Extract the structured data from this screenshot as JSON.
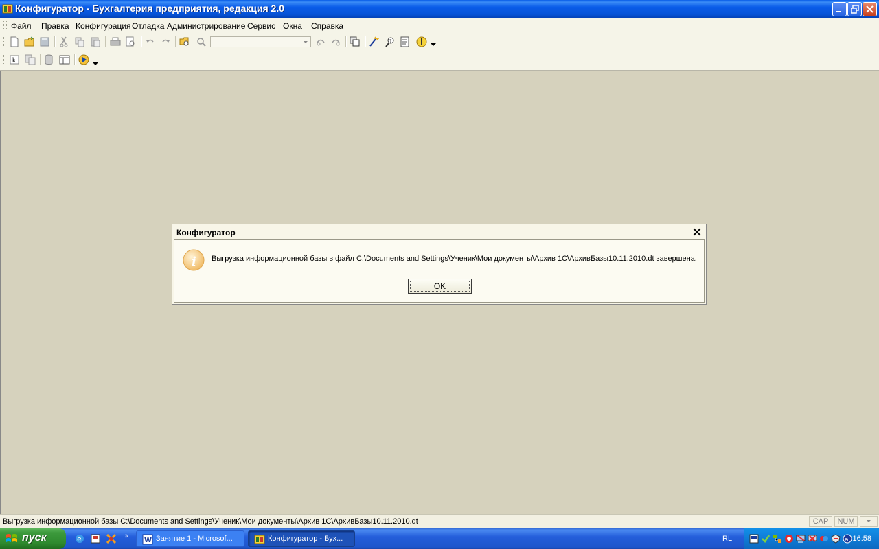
{
  "window": {
    "title": "Конфигуратор - Бухгалтерия предприятия, редакция 2.0"
  },
  "menu": {
    "items": [
      "Файл",
      "Правка",
      "Конфигурация",
      "Отладка",
      "Администрирование",
      "Сервис",
      "Окна",
      "Справка"
    ]
  },
  "toolbar1": {
    "icons": [
      "new-file-icon",
      "open-file-icon",
      "save-icon",
      "cut-icon",
      "copy-icon",
      "paste-icon",
      "print-icon",
      "print-preview-icon",
      "undo-icon",
      "redo-icon",
      "find-in-tree-icon",
      "search-icon",
      "find-next-icon",
      "find-prev-icon",
      "windows-icon",
      "wizard-icon",
      "syntax-helper-icon",
      "notes-icon",
      "info-icon"
    ],
    "search_value": ""
  },
  "toolbar2": {
    "icons": [
      "config-tree-icon",
      "config-compare-icon",
      "database-icon",
      "properties-icon",
      "run-debug-icon"
    ]
  },
  "dialog": {
    "title": "Конфигуратор",
    "message": "Выгрузка информационной базы в файл C:\\Documents and Settings\\Ученик\\Мои документы\\Архив 1С\\АрхивБазы10.11.2010.dt завершена.",
    "ok_label": "OK",
    "icon": "info-icon"
  },
  "statusbar": {
    "text": "Выгрузка информационной базы C:\\Documents and Settings\\Ученик\\Мои документы\\Архив 1С\\АрхивБазы10.11.2010.dt",
    "cap": "CAP",
    "num": "NUM"
  },
  "taskbar": {
    "start_label": "пуск",
    "tasks": [
      {
        "label": "Занятие 1 - Microsof...",
        "icon": "word-icon"
      },
      {
        "label": "Конфигуратор - Бух...",
        "icon": "1c-icon"
      }
    ],
    "lang": "RL",
    "clock": "16:58"
  },
  "colors": {
    "titlebar": "#0a5ce8",
    "workspace": "#d6d2bd",
    "taskbar": "#245edb",
    "start": "#3c9a3c"
  }
}
